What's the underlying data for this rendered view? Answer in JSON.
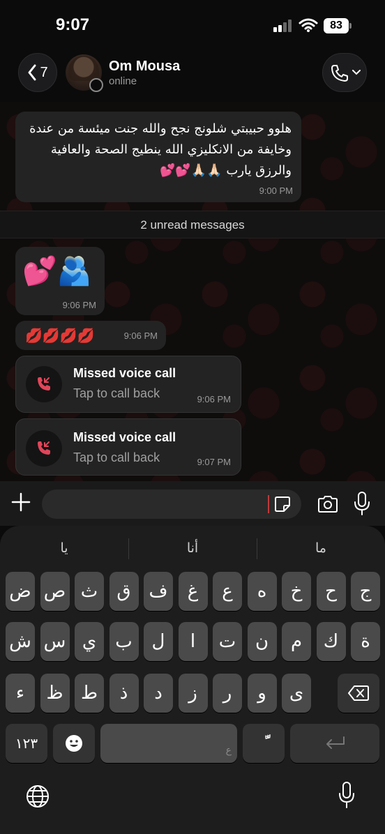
{
  "status_bar": {
    "time": "9:07",
    "battery": "83"
  },
  "header": {
    "back_count": "7",
    "contact_name": "Om Mousa",
    "contact_status": "online"
  },
  "messages": {
    "first": {
      "text": "هلوو حبيبتي شلونج نجح والله جنت ميئسة من عندة وخايفة من الانكليزي الله ينطيج الصحة والعافية والرزق يارب 🙏🏻🙏🏻💕💕",
      "time": "9:00 PM"
    },
    "unread_label": "2 unread messages",
    "second": {
      "emoji": "💕🫂",
      "time": "9:06 PM"
    },
    "third": {
      "emoji": "💋💋💋💋",
      "time": "9:06 PM"
    },
    "call1": {
      "title": "Missed voice call",
      "subtitle": "Tap to call back",
      "time": "9:06 PM"
    },
    "call2": {
      "title": "Missed voice call",
      "subtitle": "Tap to call back",
      "time": "9:07 PM"
    }
  },
  "keyboard": {
    "suggestions": [
      "يا",
      "أنا",
      "ما"
    ],
    "row1": [
      "ض",
      "ص",
      "ث",
      "ق",
      "ف",
      "غ",
      "ع",
      "ه",
      "خ",
      "ح",
      "ج"
    ],
    "row2": [
      "ش",
      "س",
      "ي",
      "ب",
      "ل",
      "ا",
      "ت",
      "ن",
      "م",
      "ك",
      "ة"
    ],
    "row3": [
      "ء",
      "ظ",
      "ط",
      "ذ",
      "د",
      "ز",
      "ر",
      "و",
      "ى"
    ],
    "numbers_key": "١٢٣",
    "space_hint": "ع",
    "diacritic_key": "ًّ"
  },
  "colors": {
    "accent_missed": "#e0465a",
    "bubble": "#232323",
    "background": "#0b0b0b"
  }
}
